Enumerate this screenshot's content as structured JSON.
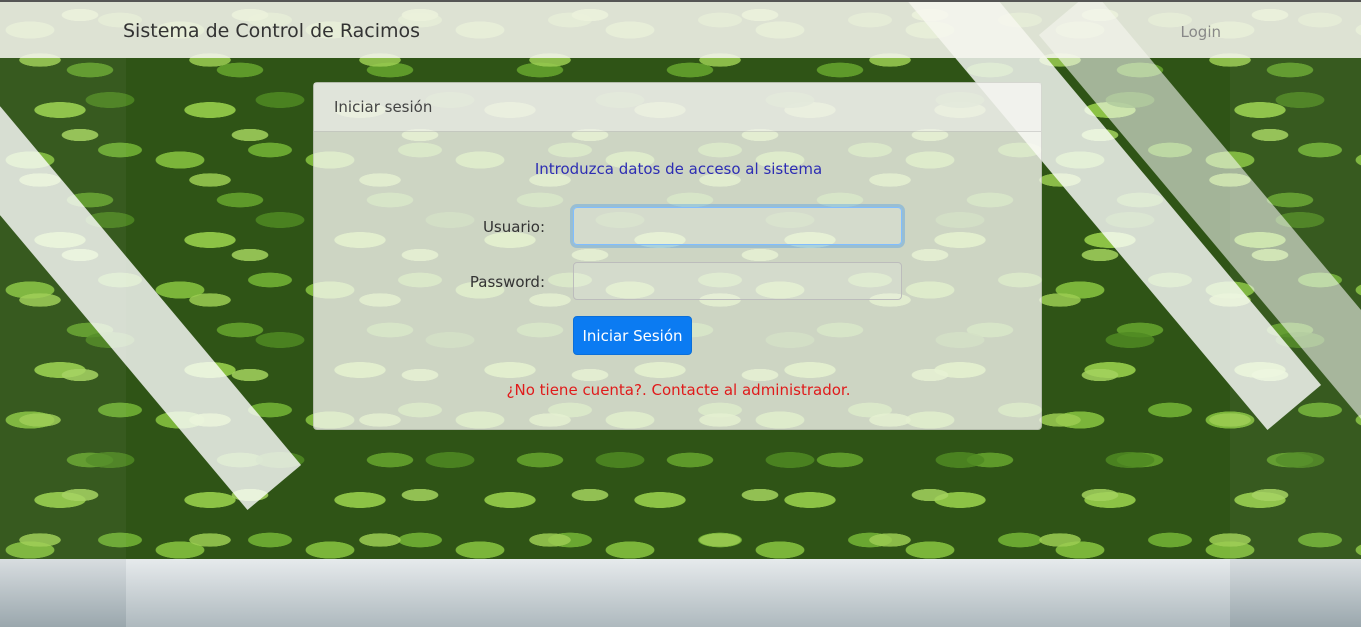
{
  "navbar": {
    "brand": "Sistema de Control de Racimos",
    "login_link": "Login"
  },
  "login_card": {
    "header": "Iniciar sesión",
    "intro": "Introduzca datos de acceso al sistema",
    "username_label": "Usuario:",
    "username_value": "",
    "password_label": "Password:",
    "password_value": "",
    "submit_label": "Iniciar Sesión",
    "no_account_text": "¿No tiene cuenta?. Contacte al administrador."
  },
  "colors": {
    "primary_button": "#0b7bf2",
    "intro_text": "#2d2db3",
    "warning_text": "#e01b1b",
    "input_focus": "#80bdff"
  }
}
